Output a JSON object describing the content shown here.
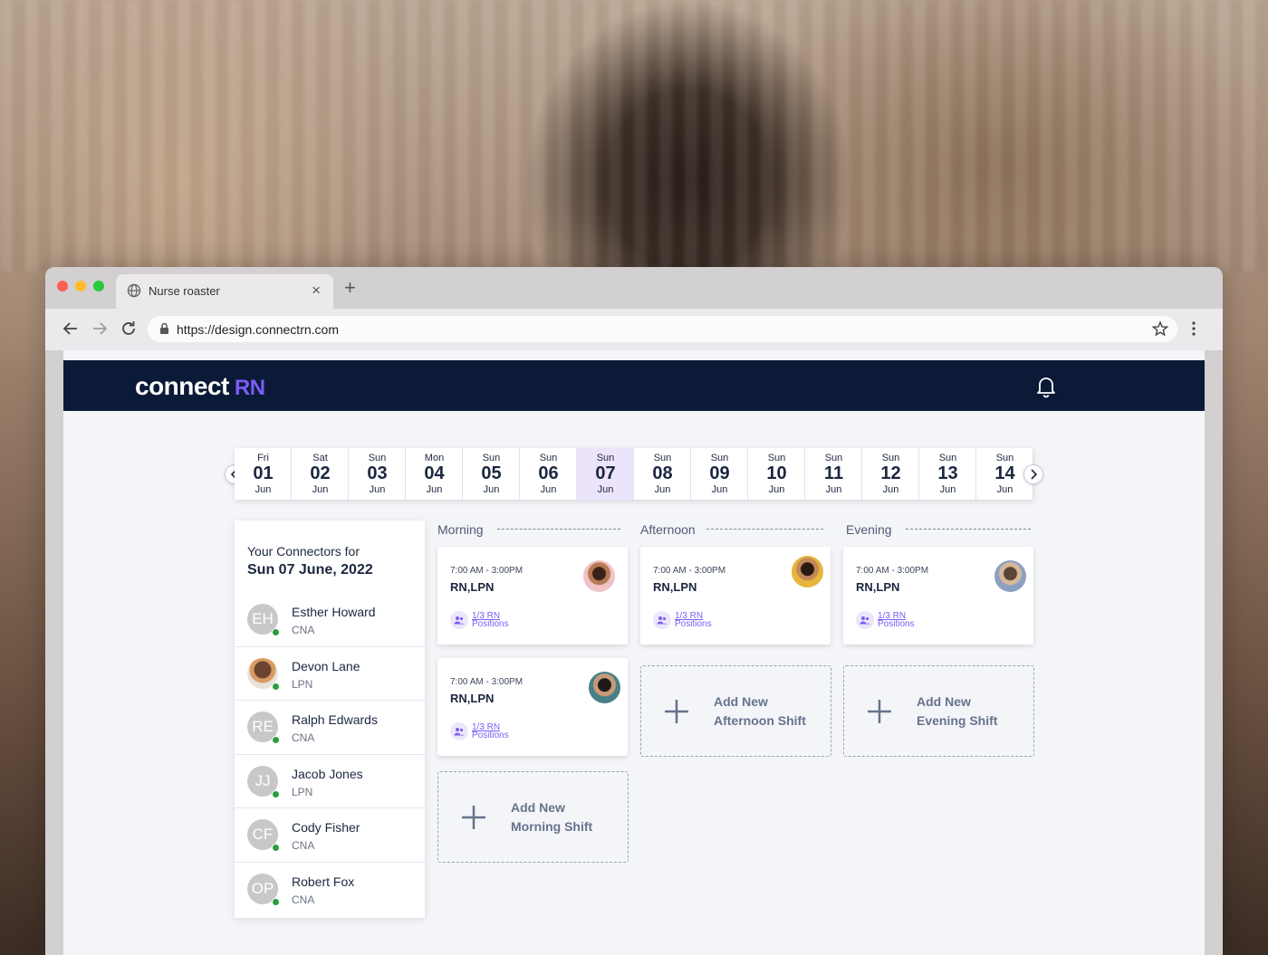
{
  "browser": {
    "tab_title": "Nurse roaster",
    "tab_close": "×",
    "new_tab": "+",
    "url": "https://design.connectrn.com"
  },
  "app": {
    "logo_main": "connect",
    "logo_accent": "RN",
    "accent_color": "#7b5cf5",
    "navbar_color": "#0b1a36"
  },
  "dates": [
    {
      "weekday": "Fri",
      "day": "01",
      "month": "Jun"
    },
    {
      "weekday": "Sat",
      "day": "02",
      "month": "Jun"
    },
    {
      "weekday": "Sun",
      "day": "03",
      "month": "Jun"
    },
    {
      "weekday": "Mon",
      "day": "04",
      "month": "Jun"
    },
    {
      "weekday": "Sun",
      "day": "05",
      "month": "Jun"
    },
    {
      "weekday": "Sun",
      "day": "06",
      "month": "Jun"
    },
    {
      "weekday": "Sun",
      "day": "07",
      "month": "Jun",
      "selected": true
    },
    {
      "weekday": "Sun",
      "day": "08",
      "month": "Jun"
    },
    {
      "weekday": "Sun",
      "day": "09",
      "month": "Jun"
    },
    {
      "weekday": "Sun",
      "day": "10",
      "month": "Jun"
    },
    {
      "weekday": "Sun",
      "day": "11",
      "month": "Jun"
    },
    {
      "weekday": "Sun",
      "day": "12",
      "month": "Jun"
    },
    {
      "weekday": "Sun",
      "day": "13",
      "month": "Jun"
    },
    {
      "weekday": "Sun",
      "day": "14",
      "month": "Jun"
    }
  ],
  "connectors": {
    "heading": "Your Connectors for",
    "date": "Sun 07 June, 2022",
    "people": [
      {
        "initials": "EH",
        "name": "Esther Howard",
        "role": "CNA"
      },
      {
        "initials": "",
        "name": "Devon Lane",
        "role": "LPN"
      },
      {
        "initials": "RE",
        "name": "Ralph Edwards",
        "role": "CNA"
      },
      {
        "initials": "JJ",
        "name": "Jacob Jones",
        "role": "LPN"
      },
      {
        "initials": "CF",
        "name": "Cody Fisher",
        "role": "CNA"
      },
      {
        "initials": "OP",
        "name": "Robert Fox",
        "role": "CNA"
      }
    ]
  },
  "columns": {
    "morning": "Morning",
    "afternoon": "Afternoon",
    "evening": "Evening"
  },
  "shifts": {
    "morning_1": {
      "time": "7:00 AM - 3:00PM",
      "roles": "RN,LPN",
      "positions": "1/3 RN",
      "positions_label": "Positions"
    },
    "morning_2": {
      "time": "7:00 AM - 3:00PM",
      "roles": "RN,LPN",
      "positions": "1/3 RN",
      "positions_label": "Positions"
    },
    "afternoon_1": {
      "time": "7:00 AM - 3:00PM",
      "roles": "RN,LPN",
      "positions": "1/3 RN",
      "positions_label": "Positions"
    },
    "evening_1": {
      "time": "7:00 AM - 3:00PM",
      "roles": "RN,LPN",
      "positions": "1/3 RN",
      "positions_label": "Positions"
    }
  },
  "add": {
    "morning": {
      "line1": "Add New",
      "line2": "Morning Shift"
    },
    "afternoon": {
      "line1": "Add New",
      "line2": "Afternoon Shift"
    },
    "evening": {
      "line1": "Add New",
      "line2": "Evening Shift"
    }
  }
}
